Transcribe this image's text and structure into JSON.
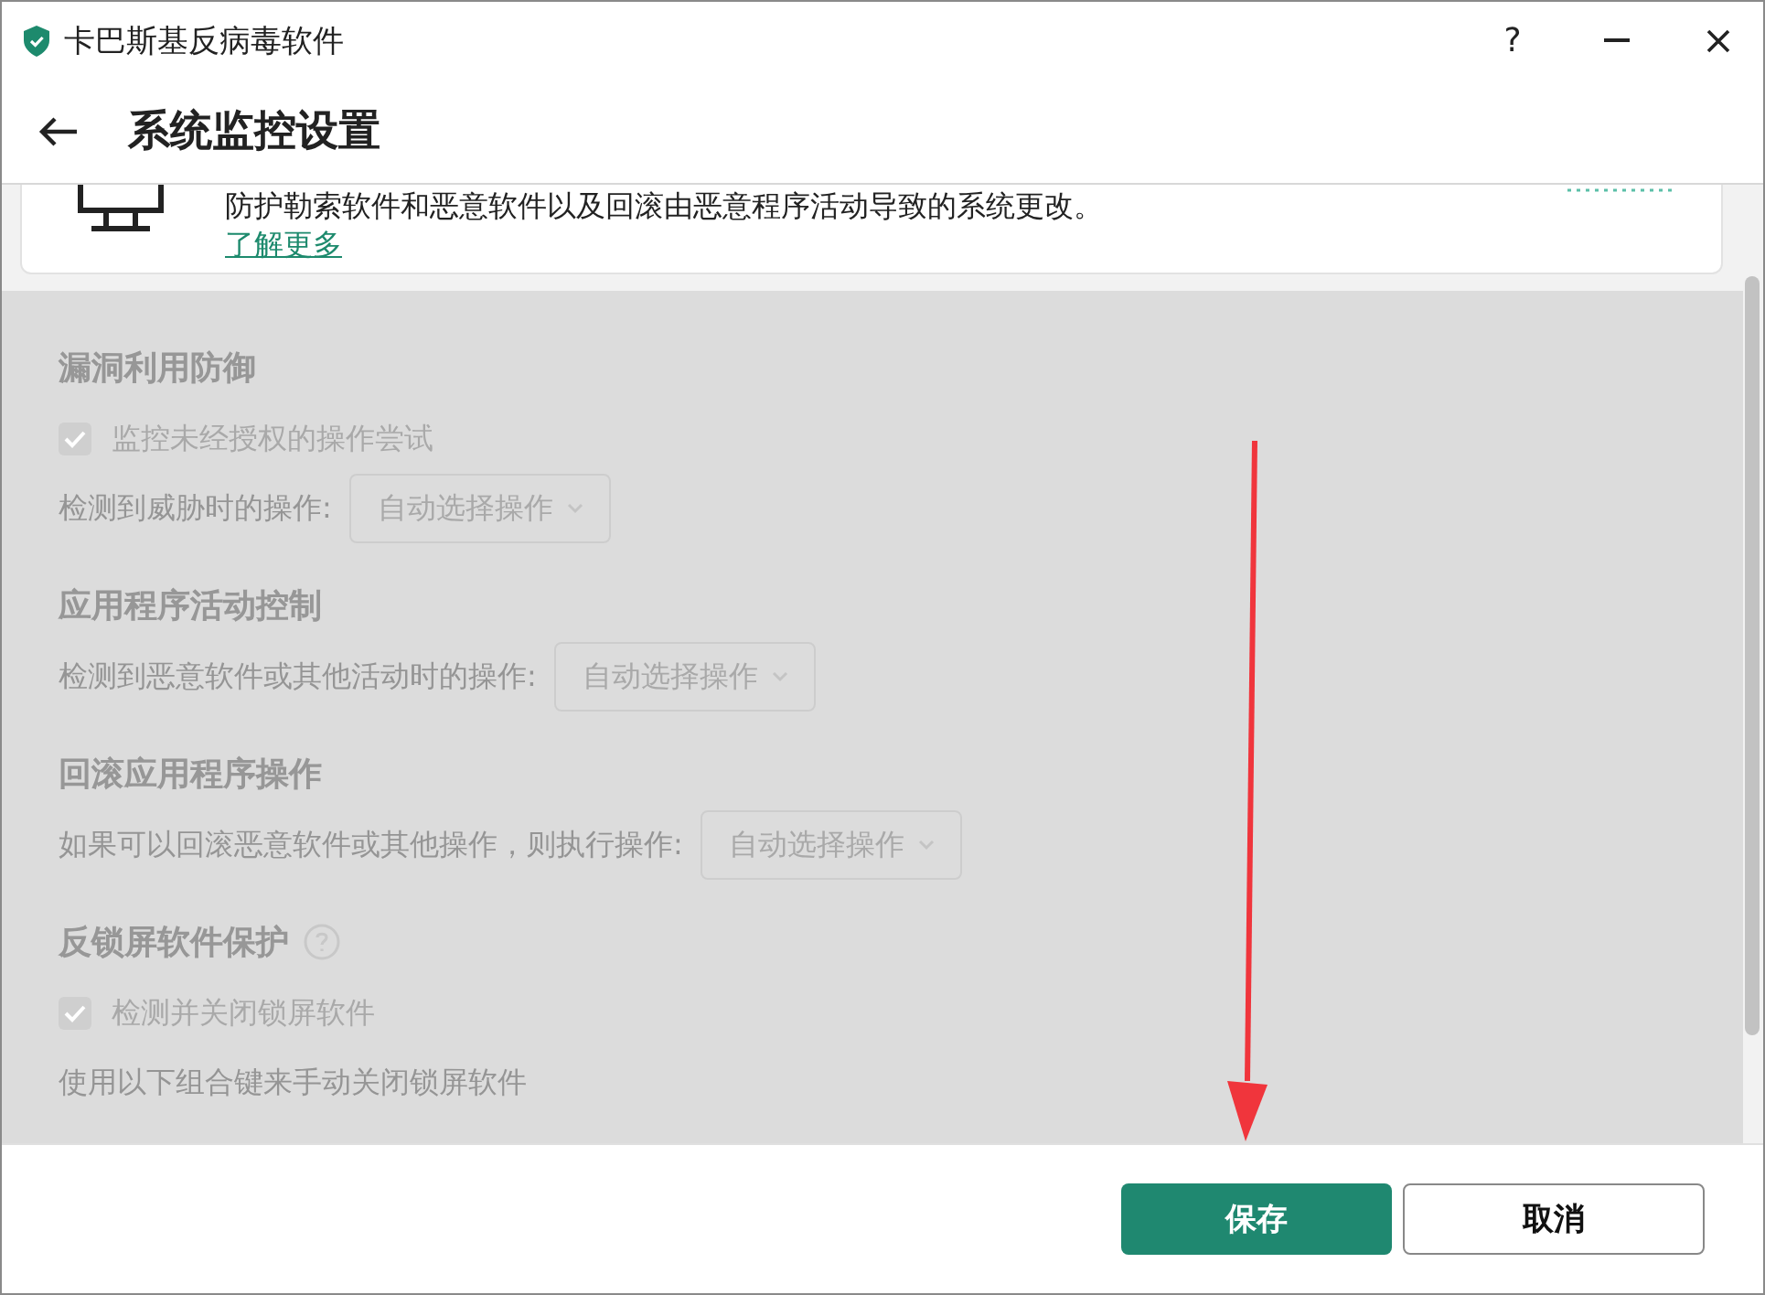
{
  "window": {
    "title": "卡巴斯基反病毒软件",
    "help": "?"
  },
  "page": {
    "title": "系统监控设置"
  },
  "intro": {
    "description": "防护勒索软件和恶意软件以及回滚由恶意程序活动导致的系统更改。",
    "link": "了解更多"
  },
  "sections": [
    {
      "title": "漏洞利用防御",
      "help": false,
      "disabled": true,
      "items": [
        {
          "kind": "checkbox",
          "label": "监控未经授权的操作尝试",
          "checked": true
        },
        {
          "kind": "select",
          "label": "检测到威胁时的操作:",
          "value": "自动选择操作"
        }
      ]
    },
    {
      "title": "应用程序活动控制",
      "help": false,
      "disabled": true,
      "items": [
        {
          "kind": "select",
          "label": "检测到恶意软件或其他活动时的操作:",
          "value": "自动选择操作"
        }
      ]
    },
    {
      "title": "回滚应用程序操作",
      "help": false,
      "disabled": true,
      "items": [
        {
          "kind": "select",
          "label": "如果可以回滚恶意软件或其他操作，则执行操作:",
          "value": "自动选择操作"
        }
      ]
    },
    {
      "title": "反锁屏软件保护",
      "help": true,
      "disabled": true,
      "items": [
        {
          "kind": "checkbox",
          "label": "检测并关闭锁屏软件",
          "checked": true
        },
        {
          "kind": "text",
          "label": "使用以下组合键来手动关闭锁屏软件"
        }
      ]
    }
  ],
  "buttons": [
    {
      "label": "保存",
      "primary": true
    },
    {
      "label": "取消",
      "primary": false
    }
  ]
}
